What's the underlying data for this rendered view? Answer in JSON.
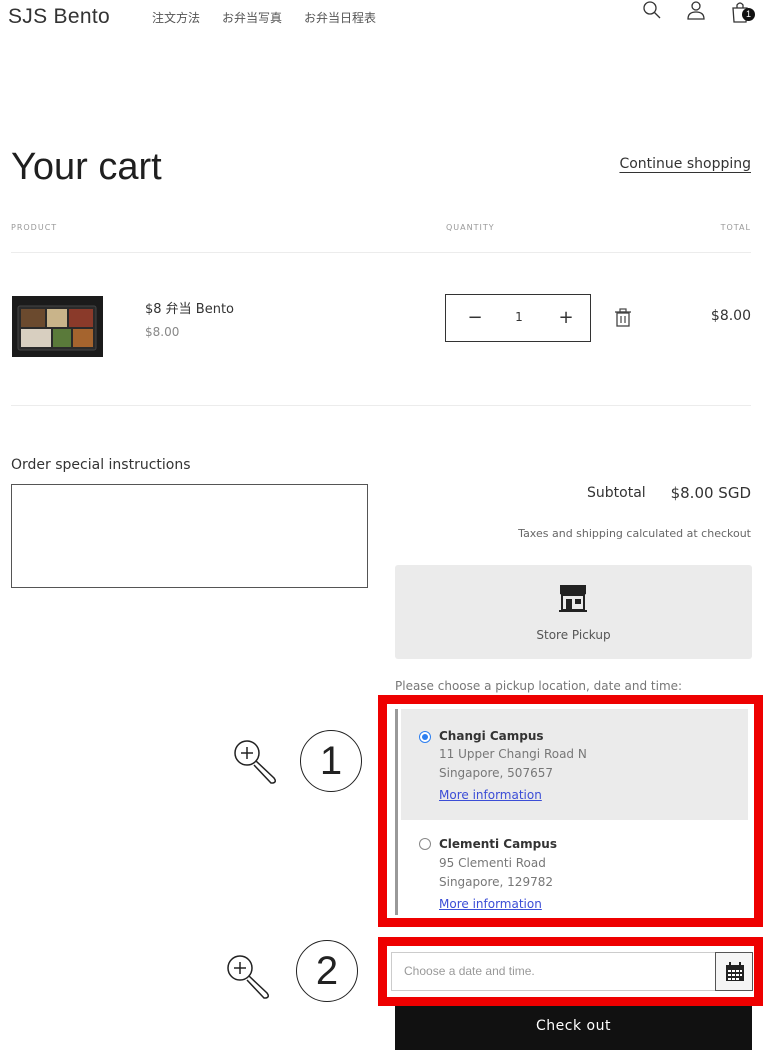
{
  "header": {
    "brand": "SJS Bento",
    "nav": [
      "注文方法",
      "お弁当写真",
      "お弁当日程表"
    ],
    "cart_count": "1"
  },
  "cart": {
    "title": "Your cart",
    "continue_label": "Continue shopping",
    "columns": {
      "product": "PRODUCT",
      "quantity": "QUANTITY",
      "total": "TOTAL"
    },
    "item": {
      "name": "$8 弁当 Bento",
      "price": "$8.00",
      "quantity": "1",
      "minus": "−",
      "plus": "+",
      "total": "$8.00"
    }
  },
  "instructions": {
    "label": "Order special instructions",
    "value": ""
  },
  "summary": {
    "subtotal_label": "Subtotal",
    "subtotal_value": "$8.00 SGD",
    "tax_note": "Taxes and shipping calculated at checkout"
  },
  "pickup": {
    "method_label": "Store Pickup",
    "prompt": "Please choose a pickup location, date and time:",
    "locations": [
      {
        "name": "Changi Campus",
        "address": "11 Upper Changi Road N",
        "city": "Singapore, 507657",
        "link": "More information",
        "selected": true
      },
      {
        "name": "Clementi Campus",
        "address": "95 Clementi Road",
        "city": "Singapore, 129782",
        "link": "More information",
        "selected": false
      }
    ],
    "date_placeholder": "Choose a date and time."
  },
  "annotations": {
    "step1": "1",
    "step2": "2"
  },
  "checkout_label": "Check out",
  "colors": {
    "highlight": "#ee0000",
    "radio": "#2d7ff0",
    "link": "#3b4dd6",
    "button": "#111111"
  },
  "icons": [
    "search-icon",
    "account-icon",
    "cart-icon",
    "trash-icon",
    "store-icon",
    "calendar-icon",
    "zoom-in-icon"
  ]
}
